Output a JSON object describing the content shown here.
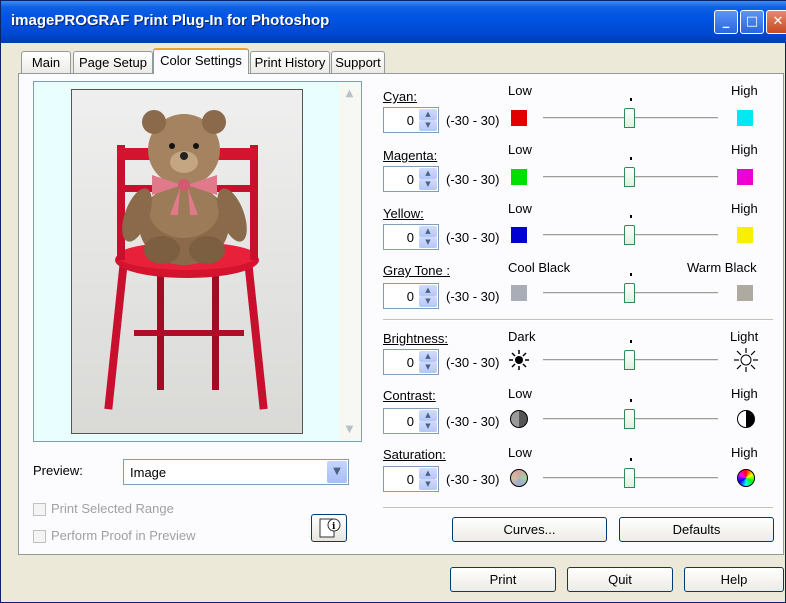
{
  "window": {
    "title": "imagePROGRAF Print Plug-In for Photoshop"
  },
  "tabs": [
    "Main",
    "Page Setup",
    "Color Settings",
    "Print History",
    "Support"
  ],
  "preview": {
    "label": "Preview:",
    "select_value": "Image",
    "print_selected_range": "Print Selected Range",
    "perform_proof": "Perform Proof in Preview"
  },
  "range": "(-30 - 30)",
  "adjustments": {
    "cyan": {
      "label": "Cyan:",
      "value": "0",
      "low": "Low",
      "high": "High",
      "low_color": "#e00000",
      "high_color": "#00e8f0"
    },
    "magenta": {
      "label": "Magenta:",
      "value": "0",
      "low": "Low",
      "high": "High",
      "low_color": "#00e000",
      "high_color": "#f000d0"
    },
    "yellow": {
      "label": "Yellow:",
      "value": "0",
      "low": "Low",
      "high": "High",
      "low_color": "#0000d0",
      "high_color": "#f8f000"
    },
    "gray_tone": {
      "label": "Gray Tone :",
      "value": "0",
      "low": "Cool Black",
      "high": "Warm Black",
      "low_color": "#a9adb8",
      "high_color": "#aeaaa0"
    },
    "brightness": {
      "label": "Brightness:",
      "value": "0",
      "low": "Dark",
      "high": "Light"
    },
    "contrast": {
      "label": "Contrast:",
      "value": "0",
      "low": "Low",
      "high": "High"
    },
    "saturation": {
      "label": "Saturation:",
      "value": "0",
      "low": "Low",
      "high": "High"
    }
  },
  "buttons": {
    "curves": "Curves...",
    "defaults": "Defaults",
    "print": "Print",
    "quit": "Quit",
    "help": "Help"
  }
}
